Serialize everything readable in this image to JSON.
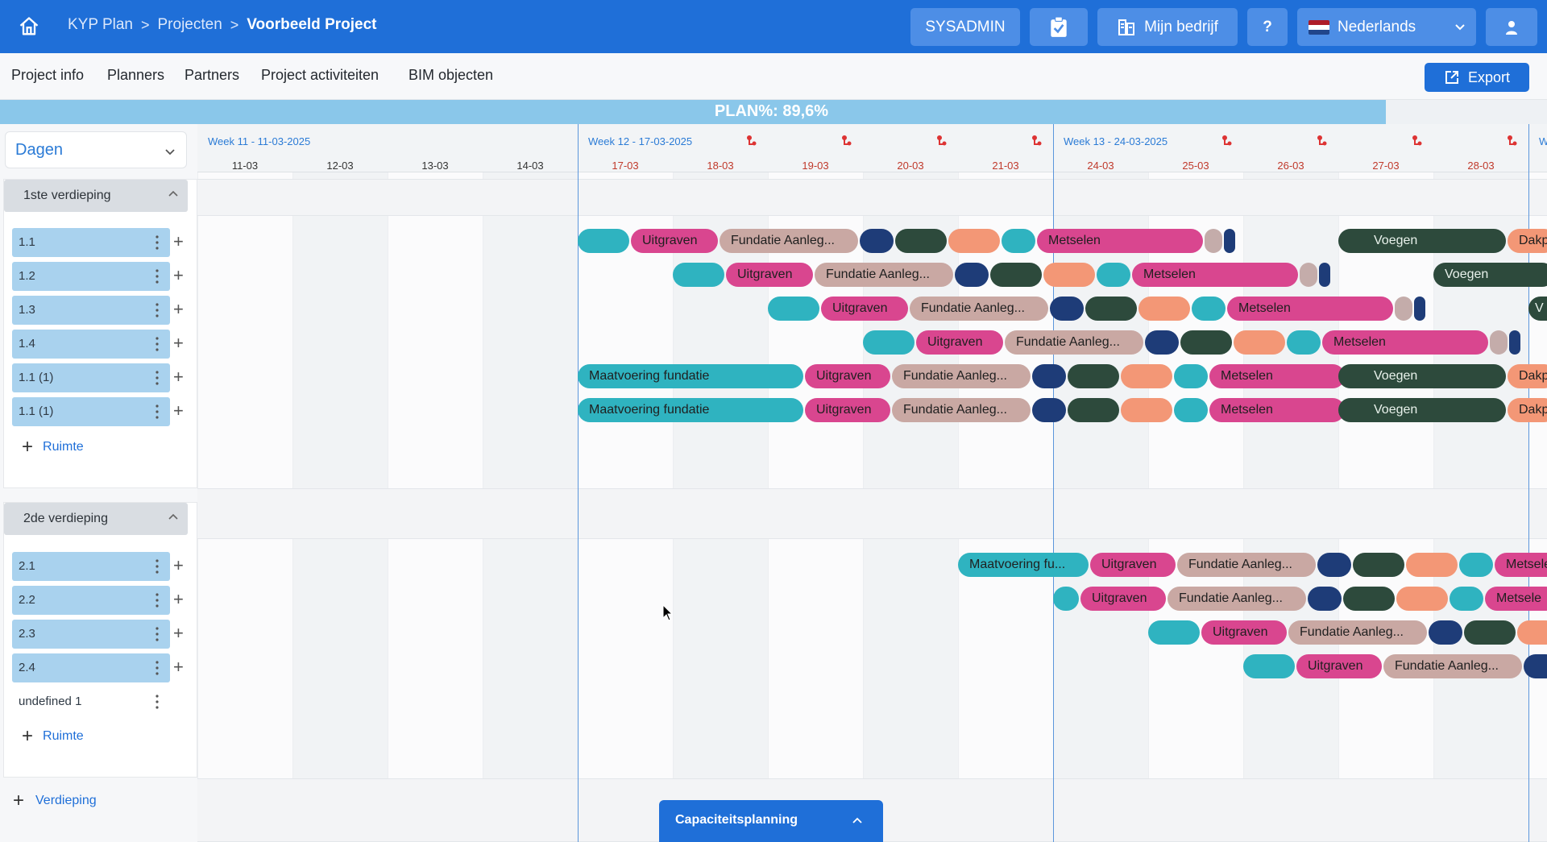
{
  "topbar": {
    "breadcrumb": [
      "KYP Plan",
      "Projecten",
      "Voorbeeld Project"
    ],
    "breadcrumb_separator": ">",
    "sysadmin_label": "SYSADMIN",
    "company_label": "Mijn bedrijf",
    "help_label": "?",
    "language_label": "Nederlands",
    "icons": {
      "home": "home-icon",
      "tasks": "clipboard-check-icon",
      "company": "building-icon",
      "language": "netherlands-flag-icon",
      "user": "user-icon"
    }
  },
  "subnav": {
    "items": [
      "Project info",
      "Planners",
      "Partners",
      "Project activiteiten",
      "BIM objecten"
    ],
    "export_label": "Export"
  },
  "plan": {
    "label": "PLAN%: 89,6%",
    "fraction": 0.896
  },
  "left": {
    "view_select": "Dagen",
    "floors": [
      {
        "name": "1ste verdieping",
        "rooms": [
          "1.1",
          "1.2",
          "1.3",
          "1.4",
          "1.1 (1)",
          "1.1 (1)"
        ],
        "add_label": "Ruimte"
      },
      {
        "name": "2de verdieping",
        "rooms": [
          "2.1",
          "2.2",
          "2.3",
          "2.4",
          "undefined 1"
        ],
        "add_label": "Ruimte"
      }
    ],
    "add_floor_label": "Verdieping"
  },
  "timeline": {
    "weeks": [
      "Week 11 - 11-03-2025",
      "Week 12 - 17-03-2025",
      "Week 13 - 24-03-2025",
      "W"
    ],
    "days": [
      "11-03",
      "12-03",
      "13-03",
      "14-03",
      "17-03",
      "18-03",
      "19-03",
      "20-03",
      "21-03",
      "24-03",
      "25-03",
      "26-03",
      "27-03",
      "28-03"
    ],
    "tasks": {
      "uitgraven": "Uitgraven",
      "fundatie": "Fundatie Aanleg...",
      "metselen": "Metselen",
      "voegen": "Voegen",
      "dakp": "Dakp",
      "maatvoering": "Maatvoering fundatie",
      "maatvoering_short": "Maatvoering fu...",
      "metsele": "Metsele",
      "v": "V"
    }
  },
  "capacity": {
    "label": "Capaciteitsplanning"
  },
  "colors": {
    "primary": "#1f6fd8",
    "teal": "#2fb3c0",
    "magenta": "#d9468f",
    "rose": "#c9a8a3",
    "navy": "#1e3c78",
    "green": "#2d4a3c",
    "orange": "#f39776",
    "room": "#a9d2ee"
  }
}
